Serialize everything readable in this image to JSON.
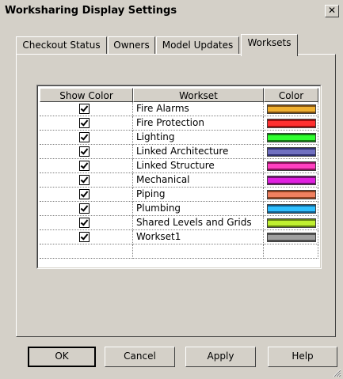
{
  "window": {
    "title": "Worksharing Display Settings",
    "close_glyph": "✕"
  },
  "tabs": [
    {
      "label": "Checkout Status",
      "active": false
    },
    {
      "label": "Owners",
      "active": false
    },
    {
      "label": "Model Updates",
      "active": false
    },
    {
      "label": "Worksets",
      "active": true
    }
  ],
  "grid": {
    "columns": [
      "Show Color",
      "Workset",
      "Color"
    ],
    "rows": [
      {
        "show": true,
        "name": "Fire Alarms",
        "color": "#f0b030",
        "color_edge": "#805010"
      },
      {
        "show": true,
        "name": "Fire Protection",
        "color": "#ff3030",
        "color_edge": "#a01010"
      },
      {
        "show": true,
        "name": "Lighting",
        "color": "#30ff30",
        "color_edge": "#108010"
      },
      {
        "show": true,
        "name": "Linked Architecture",
        "color": "#7070c0",
        "color_edge": "#303070"
      },
      {
        "show": true,
        "name": "Linked Structure",
        "color": "#ff40c0",
        "color_edge": "#901060"
      },
      {
        "show": true,
        "name": "Mechanical",
        "color": "#e020e0",
        "color_edge": "#701070"
      },
      {
        "show": true,
        "name": "Piping",
        "color": "#f08060",
        "color_edge": "#904020"
      },
      {
        "show": true,
        "name": "Plumbing",
        "color": "#30c0ff",
        "color_edge": "#106090"
      },
      {
        "show": true,
        "name": "Shared Levels and Grids",
        "color": "#c0f030",
        "color_edge": "#608010"
      },
      {
        "show": true,
        "name": "Workset1",
        "color": "#a0a0a0",
        "color_edge": "#505050"
      }
    ]
  },
  "buttons": {
    "ok": "OK",
    "cancel": "Cancel",
    "apply": "Apply",
    "help": "Help"
  }
}
